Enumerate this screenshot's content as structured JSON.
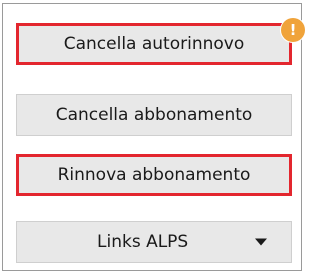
{
  "buttons": {
    "cancel_autorenew": "Cancella autorinnovo",
    "cancel_subscription": "Cancella abbonamento",
    "renew_subscription": "Rinnova abbonamento",
    "links_dropdown": "Links ALPS"
  },
  "notification_badge": {
    "symbol": "!"
  },
  "colors": {
    "highlight_border": "#e3262e",
    "badge": "#f0a33a",
    "button_bg": "#e8e8e8"
  },
  "icons": {
    "dropdown": "chevron-down-icon",
    "alert": "exclamation-icon"
  }
}
